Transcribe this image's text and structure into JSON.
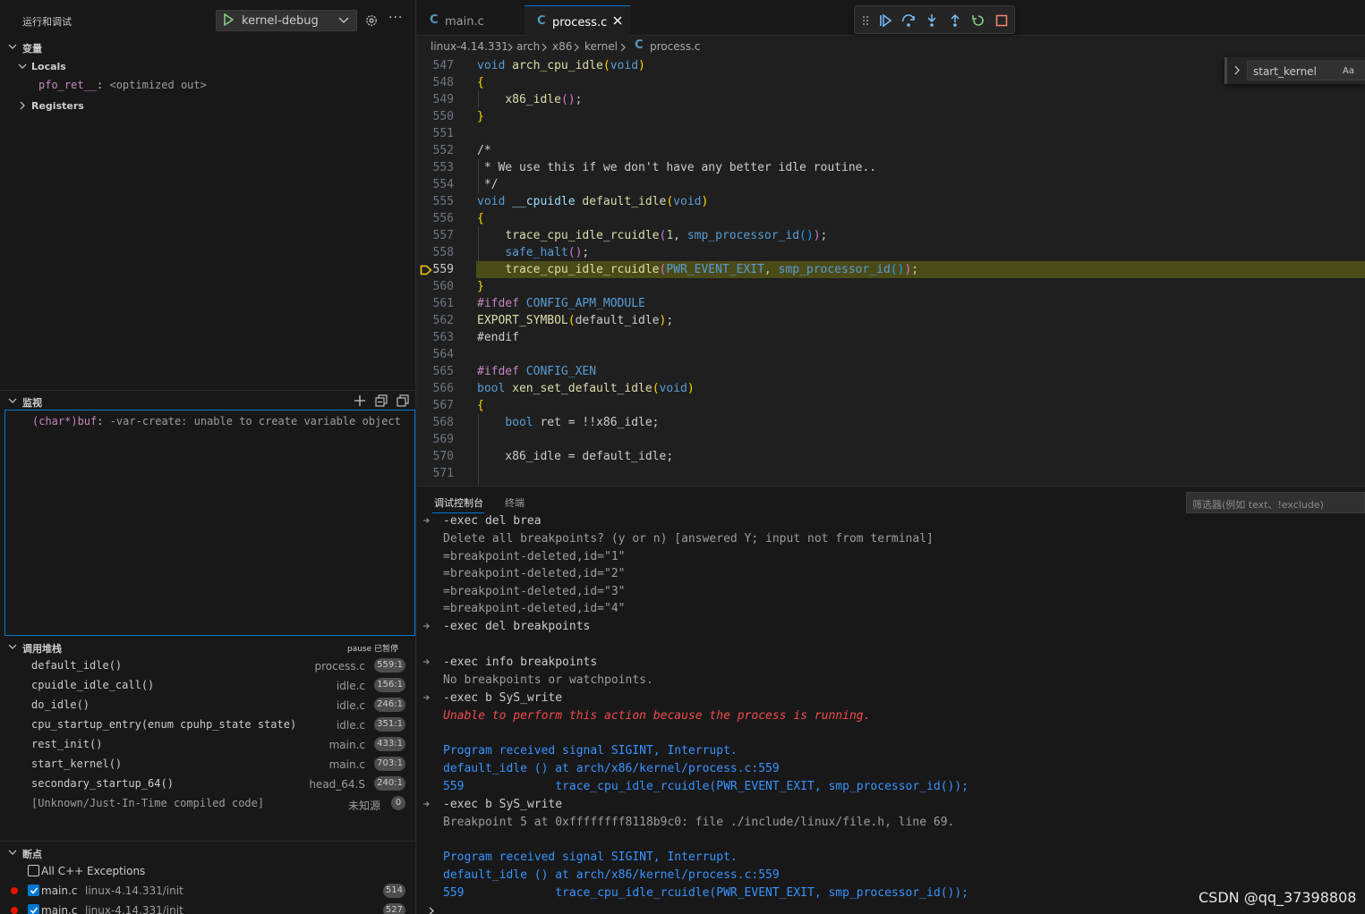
{
  "sidebar": {
    "title": "运行和调试",
    "config_name": "kernel-debug",
    "sections": {
      "variables": "变量",
      "watch": "监视",
      "callstack": "调用堆栈",
      "breakpoints": "断点"
    },
    "locals_label": "Locals",
    "registers_label": "Registers",
    "local_var": {
      "name": "pfo_ret__",
      "value": "<optimized out>"
    },
    "watch_expr": {
      "name": "(char*)buf",
      "value": "-var-create: unable to create variable object"
    },
    "callstack_status": "pause 已暂停",
    "frames": [
      {
        "fn": "default_idle()",
        "file": "process.c",
        "pos": "559:1"
      },
      {
        "fn": "cpuidle_idle_call()",
        "file": "idle.c",
        "pos": "156:1"
      },
      {
        "fn": "do_idle()",
        "file": "idle.c",
        "pos": "246:1"
      },
      {
        "fn": "cpu_startup_entry(enum cpuhp_state state)",
        "file": "idle.c",
        "pos": "351:1"
      },
      {
        "fn": "rest_init()",
        "file": "main.c",
        "pos": "433:1"
      },
      {
        "fn": "start_kernel()",
        "file": "main.c",
        "pos": "703:1"
      },
      {
        "fn": "secondary_startup_64()",
        "file": "head_64.S",
        "pos": "240:1"
      },
      {
        "fn": "[Unknown/Just-In-Time compiled code]",
        "file": "未知源",
        "pos": "0"
      }
    ],
    "breakpoints": [
      {
        "label": "All C++ Exceptions",
        "checked": false
      },
      {
        "label": "main.c",
        "path": "linux-4.14.331/init",
        "line": "514",
        "checked": true
      },
      {
        "label": "main.c",
        "path": "linux-4.14.331/init",
        "line": "527",
        "checked": true
      }
    ]
  },
  "tabs": [
    {
      "name": "main.c",
      "active": false
    },
    {
      "name": "process.c",
      "active": true
    }
  ],
  "breadcrumb": [
    "linux-4.14.331",
    "arch",
    "x86",
    "kernel",
    "process.c"
  ],
  "find": {
    "value": "start_kernel",
    "match_case_label": "Aa"
  },
  "code": {
    "current_line": "559",
    "lines": [
      {
        "n": "547",
        "t": "void arch_cpu_idle(void)"
      },
      {
        "n": "548",
        "t": "{"
      },
      {
        "n": "549",
        "t": "    x86_idle();"
      },
      {
        "n": "550",
        "t": "}"
      },
      {
        "n": "551",
        "t": ""
      },
      {
        "n": "552",
        "t": "/*"
      },
      {
        "n": "553",
        "t": " * We use this if we don't have any better idle routine.."
      },
      {
        "n": "554",
        "t": " */"
      },
      {
        "n": "555",
        "t": "void __cpuidle default_idle(void)"
      },
      {
        "n": "556",
        "t": "{"
      },
      {
        "n": "557",
        "t": "    trace_cpu_idle_rcuidle(1, smp_processor_id());"
      },
      {
        "n": "558",
        "t": "    safe_halt();"
      },
      {
        "n": "559",
        "t": "    trace_cpu_idle_rcuidle(PWR_EVENT_EXIT, smp_processor_id());"
      },
      {
        "n": "560",
        "t": "}"
      },
      {
        "n": "561",
        "t": "#ifdef CONFIG_APM_MODULE"
      },
      {
        "n": "562",
        "t": "EXPORT_SYMBOL(default_idle);"
      },
      {
        "n": "563",
        "t": "#endif"
      },
      {
        "n": "564",
        "t": ""
      },
      {
        "n": "565",
        "t": "#ifdef CONFIG_XEN"
      },
      {
        "n": "566",
        "t": "bool xen_set_default_idle(void)"
      },
      {
        "n": "567",
        "t": "{"
      },
      {
        "n": "568",
        "t": "    bool ret = !!x86_idle;"
      },
      {
        "n": "569",
        "t": ""
      },
      {
        "n": "570",
        "t": "    x86_idle = default_idle;"
      },
      {
        "n": "571",
        "t": ""
      }
    ]
  },
  "panel": {
    "tabs": [
      "调试控制台",
      "终端"
    ],
    "filter_placeholder": "筛选器(例如 text、!exclude)",
    "console": [
      {
        "t": "-exec del brea",
        "k": "in"
      },
      {
        "t": "Delete all breakpoints? (y or n) [answered Y; input not from terminal]",
        "k": "out"
      },
      {
        "t": "=breakpoint-deleted,id=\"1\"",
        "k": "out"
      },
      {
        "t": "=breakpoint-deleted,id=\"2\"",
        "k": "out"
      },
      {
        "t": "=breakpoint-deleted,id=\"3\"",
        "k": "out"
      },
      {
        "t": "=breakpoint-deleted,id=\"4\"",
        "k": "out"
      },
      {
        "t": "-exec del breakpoints",
        "k": "in"
      },
      {
        "t": "",
        "k": "out"
      },
      {
        "t": "-exec info breakpoints",
        "k": "in"
      },
      {
        "t": "No breakpoints or watchpoints.",
        "k": "out"
      },
      {
        "t": "-exec b SyS_write",
        "k": "in"
      },
      {
        "t": "Unable to perform this action because the process is running.",
        "k": "err"
      },
      {
        "t": "",
        "k": "out"
      },
      {
        "t": "Program received signal SIGINT, Interrupt.",
        "k": "sig"
      },
      {
        "t": "default_idle () at arch/x86/kernel/process.c:559",
        "k": "sig"
      },
      {
        "t": "559             trace_cpu_idle_rcuidle(PWR_EVENT_EXIT, smp_processor_id());",
        "k": "sig"
      },
      {
        "t": "-exec b SyS_write",
        "k": "in"
      },
      {
        "t": "Breakpoint 5 at 0xffffffff8118b9c0: file ./include/linux/file.h, line 69.",
        "k": "out"
      },
      {
        "t": "",
        "k": "out"
      },
      {
        "t": "Program received signal SIGINT, Interrupt.",
        "k": "sig"
      },
      {
        "t": "default_idle () at arch/x86/kernel/process.c:559",
        "k": "sig"
      },
      {
        "t": "559             trace_cpu_idle_rcuidle(PWR_EVENT_EXIT, smp_processor_id());",
        "k": "sig"
      }
    ]
  },
  "watermark": "CSDN @qq_37398808",
  "colors": {
    "accent": "#0078d4",
    "current_line": "#4b4b18",
    "breakpoint": "#e51400",
    "debug_arrow": "#ffcc00"
  }
}
